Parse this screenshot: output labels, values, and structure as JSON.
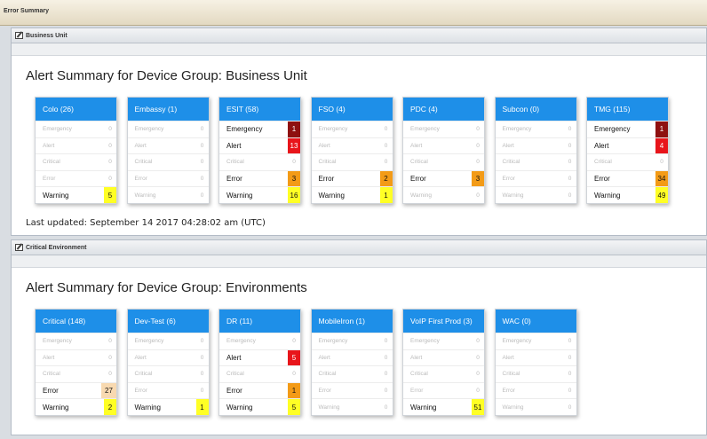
{
  "page_title": "Error Summary",
  "colors": {
    "header_blue": "#1e8fe8",
    "emergency": "#8e1010",
    "alert": "#e8151b",
    "error": "#f39b17",
    "warning": "#ffff25"
  },
  "panels": [
    {
      "title": "Business Unit",
      "heading": "Alert Summary for Device Group: Business Unit",
      "last_updated": "Last updated: September 14 2017 04:28:02 am (UTC)",
      "cards": [
        {
          "title": "Colo (26)",
          "rows": [
            {
              "label": "Emergency",
              "value": "0"
            },
            {
              "label": "Alert",
              "value": "0"
            },
            {
              "label": "Critical",
              "value": "0"
            },
            {
              "label": "Error",
              "value": "0"
            },
            {
              "label": "Warning",
              "value": "5",
              "level": "warning"
            }
          ]
        },
        {
          "title": "Embassy (1)",
          "rows": [
            {
              "label": "Emergency",
              "value": "0"
            },
            {
              "label": "Alert",
              "value": "0"
            },
            {
              "label": "Critical",
              "value": "0"
            },
            {
              "label": "Error",
              "value": "0"
            },
            {
              "label": "Warning",
              "value": "0"
            }
          ]
        },
        {
          "title": "ESIT (58)",
          "rows": [
            {
              "label": "Emergency",
              "value": "1",
              "level": "emergency"
            },
            {
              "label": "Alert",
              "value": "13",
              "level": "alert"
            },
            {
              "label": "Critical",
              "value": "0"
            },
            {
              "label": "Error",
              "value": "3",
              "level": "error"
            },
            {
              "label": "Warning",
              "value": "16",
              "level": "warning"
            }
          ]
        },
        {
          "title": "FSO (4)",
          "rows": [
            {
              "label": "Emergency",
              "value": "0"
            },
            {
              "label": "Alert",
              "value": "0"
            },
            {
              "label": "Critical",
              "value": "0"
            },
            {
              "label": "Error",
              "value": "2",
              "level": "error"
            },
            {
              "label": "Warning",
              "value": "1",
              "level": "warning"
            }
          ]
        },
        {
          "title": "PDC (4)",
          "rows": [
            {
              "label": "Emergency",
              "value": "0"
            },
            {
              "label": "Alert",
              "value": "0"
            },
            {
              "label": "Critical",
              "value": "0"
            },
            {
              "label": "Error",
              "value": "3",
              "level": "error"
            },
            {
              "label": "Warning",
              "value": "0"
            }
          ]
        },
        {
          "title": "Subcon (0)",
          "rows": [
            {
              "label": "Emergency",
              "value": "0"
            },
            {
              "label": "Alert",
              "value": "0"
            },
            {
              "label": "Critical",
              "value": "0"
            },
            {
              "label": "Error",
              "value": "0"
            },
            {
              "label": "Warning",
              "value": "0"
            }
          ]
        },
        {
          "title": "TMG (115)",
          "rows": [
            {
              "label": "Emergency",
              "value": "1",
              "level": "emergency"
            },
            {
              "label": "Alert",
              "value": "4",
              "level": "alert"
            },
            {
              "label": "Critical",
              "value": "0"
            },
            {
              "label": "Error",
              "value": "34",
              "level": "error"
            },
            {
              "label": "Warning",
              "value": "49",
              "level": "warning"
            }
          ]
        }
      ]
    },
    {
      "title": "Critical Environment",
      "heading": "Alert Summary for Device Group: Environments",
      "cards": [
        {
          "title": "Critical (148)",
          "rows": [
            {
              "label": "Emergency",
              "value": "0"
            },
            {
              "label": "Alert",
              "value": "0"
            },
            {
              "label": "Critical",
              "value": "0"
            },
            {
              "label": "Error",
              "value": "27",
              "level": "error-light"
            },
            {
              "label": "Warning",
              "value": "2",
              "level": "warning"
            }
          ]
        },
        {
          "title": "Dev-Test (6)",
          "rows": [
            {
              "label": "Emergency",
              "value": "0"
            },
            {
              "label": "Alert",
              "value": "0"
            },
            {
              "label": "Critical",
              "value": "0"
            },
            {
              "label": "Error",
              "value": "0"
            },
            {
              "label": "Warning",
              "value": "1",
              "level": "warning"
            }
          ]
        },
        {
          "title": "DR (11)",
          "rows": [
            {
              "label": "Emergency",
              "value": "0"
            },
            {
              "label": "Alert",
              "value": "5",
              "level": "alert"
            },
            {
              "label": "Critical",
              "value": "0"
            },
            {
              "label": "Error",
              "value": "1",
              "level": "error"
            },
            {
              "label": "Warning",
              "value": "5",
              "level": "warning"
            }
          ]
        },
        {
          "title": "MobileIron (1)",
          "rows": [
            {
              "label": "Emergency",
              "value": "0"
            },
            {
              "label": "Alert",
              "value": "0"
            },
            {
              "label": "Critical",
              "value": "0"
            },
            {
              "label": "Error",
              "value": "0"
            },
            {
              "label": "Warning",
              "value": "0"
            }
          ]
        },
        {
          "title": "VoIP First Prod (3)",
          "rows": [
            {
              "label": "Emergency",
              "value": "0"
            },
            {
              "label": "Alert",
              "value": "0"
            },
            {
              "label": "Critical",
              "value": "0"
            },
            {
              "label": "Error",
              "value": "0"
            },
            {
              "label": "Warning",
              "value": "51",
              "level": "warning"
            }
          ]
        },
        {
          "title": "WAC (0)",
          "rows": [
            {
              "label": "Emergency",
              "value": "0"
            },
            {
              "label": "Alert",
              "value": "0"
            },
            {
              "label": "Critical",
              "value": "0"
            },
            {
              "label": "Error",
              "value": "0"
            },
            {
              "label": "Warning",
              "value": "0"
            }
          ]
        }
      ]
    }
  ]
}
